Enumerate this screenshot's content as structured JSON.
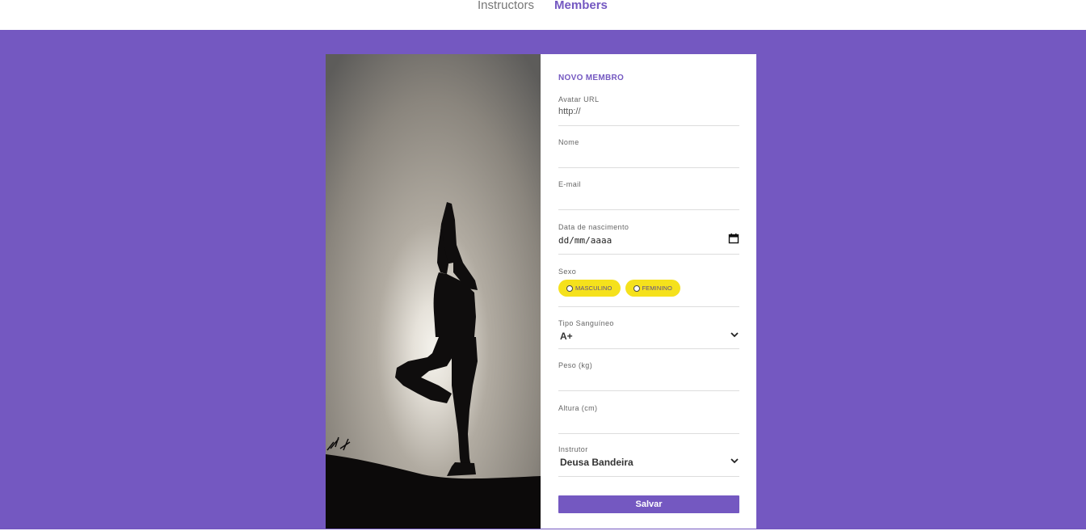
{
  "nav": {
    "items": [
      {
        "label": "Instructors",
        "active": false
      },
      {
        "label": "Members",
        "active": true
      }
    ]
  },
  "form": {
    "title": "NOVO MEMBRO",
    "avatar": {
      "label": "Avatar URL",
      "placeholder": "http://"
    },
    "nome": {
      "label": "Nome",
      "value": ""
    },
    "email": {
      "label": "E-mail",
      "value": ""
    },
    "data_nascimento": {
      "label": "Data de nascimento",
      "placeholder": "dd/mm/aaaa"
    },
    "sexo": {
      "label": "Sexo",
      "options": [
        {
          "label": "MASCULINO",
          "checked": false
        },
        {
          "label": "FEMININO",
          "checked": false
        }
      ]
    },
    "tipo_sanguineo": {
      "label": "Tipo Sanguíneo",
      "selected": "A+"
    },
    "peso": {
      "label": "Peso (kg)",
      "value": ""
    },
    "altura": {
      "label": "Altura (cm)",
      "value": ""
    },
    "instrutor": {
      "label": "Instrutor",
      "selected": "Deusa Bandeira"
    },
    "save_label": "Salvar"
  },
  "icons": {
    "calendar": "calendar-icon",
    "chevron": "chevron-down-icon"
  },
  "colors": {
    "accent": "#7458c1",
    "radio_pill": "#f5e11c",
    "background": "#7458c1"
  }
}
